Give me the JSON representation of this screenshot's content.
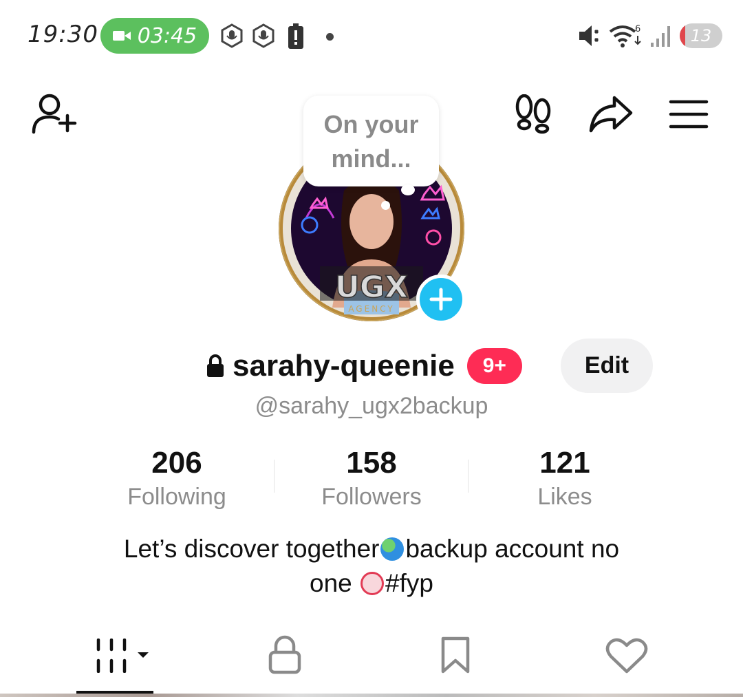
{
  "status_bar": {
    "time": "19:30",
    "call_timer": "03:45",
    "battery": "13",
    "battery_level": 0.13,
    "icons": [
      "video-call-icon",
      "mic-hex-icon",
      "mic-hex-icon",
      "battery-alert-icon",
      "dot-icon",
      "mute-icon",
      "wifi-icon",
      "signal-icon"
    ]
  },
  "header": {
    "add_friend_icon": "add-user-icon",
    "footprints_icon": "footprints-icon",
    "share_icon": "share-icon",
    "menu_icon": "menu-icon"
  },
  "bubble": {
    "text_line1": "On your",
    "text_line2": "mind..."
  },
  "profile": {
    "username": "sarahy-queenie",
    "badge": "9+",
    "edit_label": "Edit",
    "handle": "@sarahy_ugx2backup",
    "lock_icon": "lock-icon"
  },
  "stats": [
    {
      "value": "206",
      "label": "Following"
    },
    {
      "value": "158",
      "label": "Followers"
    },
    {
      "value": "121",
      "label": "Likes"
    }
  ],
  "bio": {
    "line1_a": "Let’s discover together",
    "line1_b": "backup account no",
    "line2_a": "one ",
    "line2_b": "#fyp"
  },
  "tabs": [
    "videos-grid-icon",
    "private-lock-icon",
    "bookmark-icon",
    "heart-icon"
  ],
  "colors": {
    "accent": "#fe2c55",
    "cyan": "#20c0f2",
    "green_pill": "#5cc05e"
  }
}
